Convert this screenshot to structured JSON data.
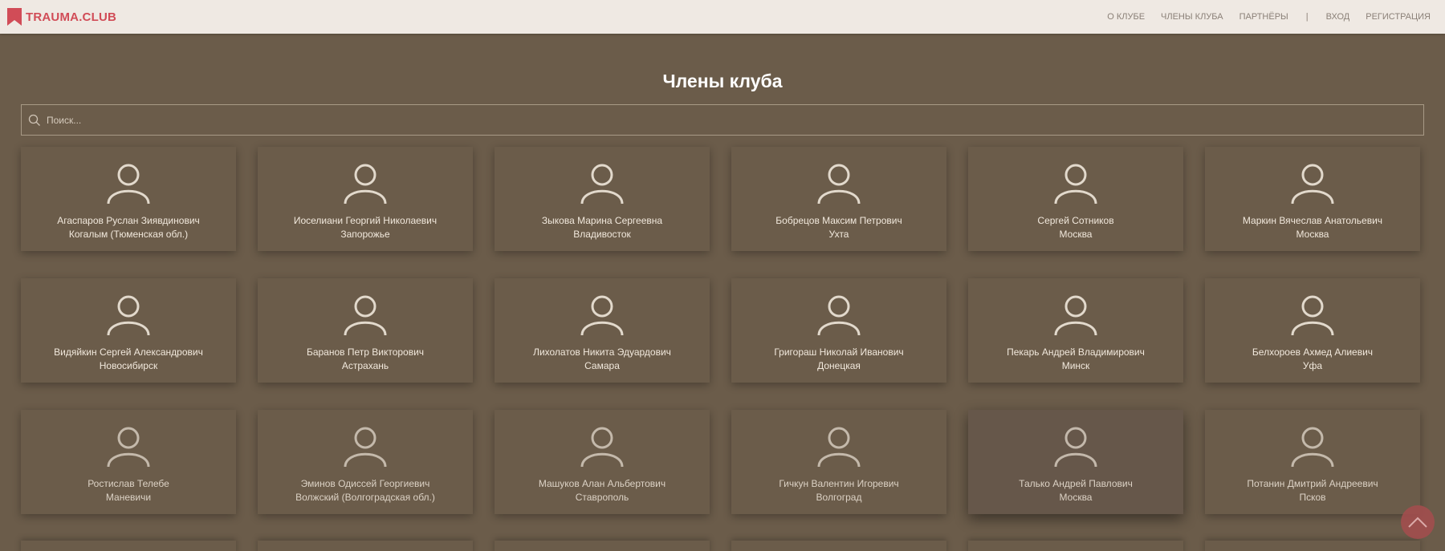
{
  "header": {
    "brand": "TRAUMA.CLUB",
    "brand_icon": "bookmark-icon",
    "nav": {
      "about": "О КЛУБЕ",
      "members": "ЧЛЕНЫ КЛУБА",
      "partners": "ПАРТНЁРЫ",
      "separator": "|",
      "login": "ВХОД",
      "register": "РЕГИСТРАЦИЯ"
    }
  },
  "main": {
    "title": "Члены клуба",
    "search": {
      "placeholder": "Поиск...",
      "value": "",
      "icon": "search-icon"
    },
    "members": [
      {
        "name": "Агаспаров Руслан Зиявдинович",
        "city": "Когалым (Тюменская обл.)"
      },
      {
        "name": "Иоселиани Георгий Николаевич",
        "city": "Запорожье"
      },
      {
        "name": "Зыкова Марина Сергеевна",
        "city": "Владивосток"
      },
      {
        "name": "Бобрецов Максим Петрович",
        "city": "Ухта"
      },
      {
        "name": "Сергей Сотников",
        "city": "Москва"
      },
      {
        "name": "Маркин Вячеслав Анатольевич",
        "city": "Москва"
      },
      {
        "name": "Видяйкин Сергей Александрович",
        "city": "Новосибирск"
      },
      {
        "name": "Баранов Петр Викторович",
        "city": "Астрахань"
      },
      {
        "name": "Лихолатов Никита Эдуардович",
        "city": "Самара"
      },
      {
        "name": "Григораш Николай Иванович",
        "city": "Донецкая"
      },
      {
        "name": "Пекарь Андрей Владимирович",
        "city": "Минск"
      },
      {
        "name": "Белхороев Ахмед Алиевич",
        "city": "Уфа"
      },
      {
        "name": "Ростислав Телебе",
        "city": "Маневичи"
      },
      {
        "name": "Эминов Одиссей Георгиевич",
        "city": "Волжский (Волгоградская обл.)"
      },
      {
        "name": "Машуков Алан Альбертович",
        "city": "Ставрополь"
      },
      {
        "name": "Гичкун Валентин Игоревич",
        "city": "Волгоград"
      },
      {
        "name": "Талько Андрей Павлович",
        "city": "Москва"
      },
      {
        "name": "Потанин Дмитрий Андреевич",
        "city": "Псков"
      }
    ]
  },
  "scroll_top": {
    "icon": "chevron-up-icon"
  },
  "colors": {
    "background": "#6b5c4a",
    "navbar": "#efe9e3",
    "brand": "#d14c57",
    "scroll_button": "#a24e4e"
  }
}
